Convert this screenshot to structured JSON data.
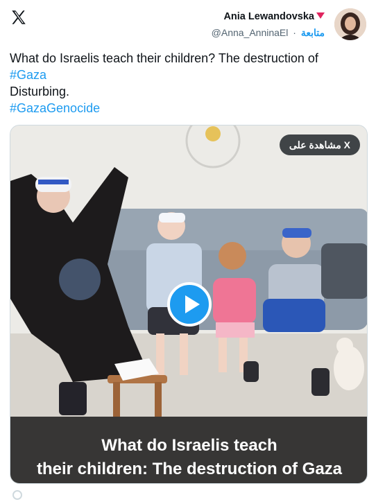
{
  "author": {
    "name": "Ania Lewandovska",
    "follow_label": "متابعة",
    "separator": "·",
    "handle": "@Anna_AnninaEl"
  },
  "tweet": {
    "line1": "What do Israelis teach their children? The destruction of",
    "hashtag1": "#Gaza",
    "line2": "Disturbing.",
    "hashtag2": "#GazaGenocide"
  },
  "media": {
    "watch_label": "مشاهدة على X",
    "caption_line1": "What do Israelis teach",
    "caption_line2": "their children: The destruction of Gaza"
  },
  "colors": {
    "accent": "#1d9bf0",
    "verified_badge": "#e0245e",
    "text": "#0f1419",
    "muted": "#536471"
  }
}
